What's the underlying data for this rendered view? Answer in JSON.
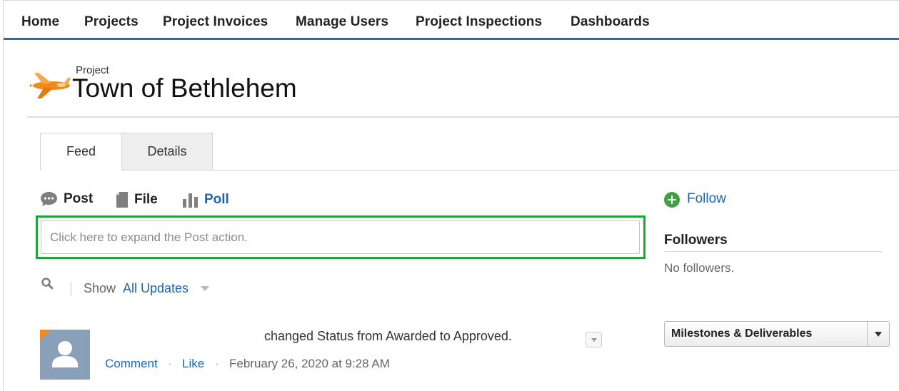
{
  "nav": {
    "items": [
      "Home",
      "Projects",
      "Project Invoices",
      "Manage Users",
      "Project Inspections",
      "Dashboards"
    ]
  },
  "header": {
    "object_label": "Project",
    "title": "Town of Bethlehem",
    "icon": "airplane-icon"
  },
  "tabs": [
    {
      "label": "Feed",
      "active": true
    },
    {
      "label": "Details",
      "active": false
    }
  ],
  "publisher": {
    "actions": [
      {
        "label": "Post",
        "icon": "speech-bubble-icon"
      },
      {
        "label": "File",
        "icon": "document-icon"
      },
      {
        "label": "Poll",
        "icon": "bar-chart-icon"
      }
    ],
    "placeholder": "Click here to expand the Post action."
  },
  "filter": {
    "show_label": "Show",
    "value": "All Updates"
  },
  "feed": [
    {
      "text": "changed Status from Awarded to Approved.",
      "comment_label": "Comment",
      "like_label": "Like",
      "separator": "·",
      "timestamp": "February 26, 2020 at 9:28 AM"
    }
  ],
  "sidebar": {
    "follow_label": "Follow",
    "followers_title": "Followers",
    "followers_empty": "No followers.",
    "related_select": "Milestones & Deliverables"
  },
  "colors": {
    "nav_accent": "#1f6fc5",
    "link": "#1c65b3",
    "highlight_border": "#1fa33a",
    "follow_green": "#3ea33e",
    "icon_orange": "#f18a1d"
  }
}
